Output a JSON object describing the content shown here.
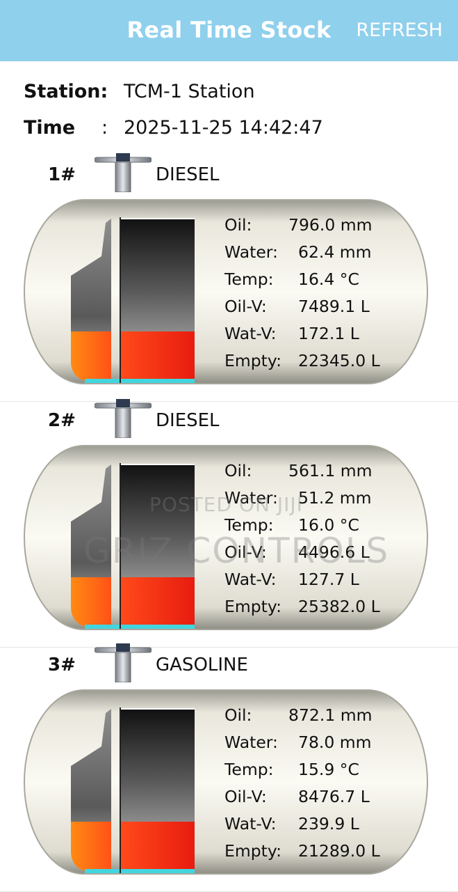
{
  "header": {
    "title": "Real Time Stock",
    "refresh_label": "REFRESH"
  },
  "station": {
    "label": "Station:",
    "value": "TCM-1 Station"
  },
  "time": {
    "label": "Time",
    "separator": ":",
    "value": "2025-11-25 14:42:47"
  },
  "tanks": [
    {
      "number": "1#",
      "fuel": "DIESEL",
      "oil_label": "Oil:",
      "oil": "796.0 mm",
      "water_label": "Water:",
      "water": "62.4 mm",
      "temp_label": "Temp:",
      "temp": "16.4 °C",
      "oilv_label": "Oil-V:",
      "oil_volume": "7489.1 L",
      "watv_label": "Wat-V:",
      "water_volume": "172.1 L",
      "empty_label": "Empty:",
      "empty": "22345.0 L"
    },
    {
      "number": "2#",
      "fuel": "DIESEL",
      "oil_label": "Oil:",
      "oil": "561.1 mm",
      "water_label": "Water:",
      "water": "51.2 mm",
      "temp_label": "Temp:",
      "temp": "16.0 °C",
      "oilv_label": "Oil-V:",
      "oil_volume": "4496.6 L",
      "watv_label": "Wat-V:",
      "water_volume": "127.7 L",
      "empty_label": "Empty:",
      "empty": "25382.0 L"
    },
    {
      "number": "3#",
      "fuel": "GASOLINE",
      "oil_label": "Oil:",
      "oil": "872.1 mm",
      "water_label": "Water:",
      "water": "78.0 mm",
      "temp_label": "Temp:",
      "temp": "15.9 °C",
      "oilv_label": "Oil-V:",
      "oil_volume": "8476.7 L",
      "watv_label": "Wat-V:",
      "water_volume": "239.9 L",
      "empty_label": "Empty:",
      "empty": "21289.0 L"
    }
  ],
  "watermark": {
    "line1": "POSTED ON JIJI",
    "line2": "GRIZ CONTROLS"
  },
  "colors": {
    "header_bg": "#8fd0ec",
    "oil_fill": "#ff7a10",
    "water_fill": "#40d8e0",
    "tank_body": "#e8e6dc"
  }
}
